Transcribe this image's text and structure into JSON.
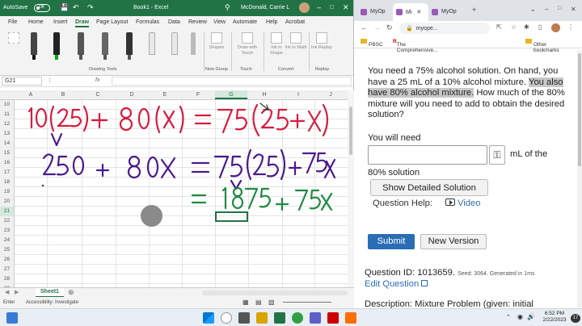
{
  "excel": {
    "autosave_label": "AutoSave",
    "autosave_state": "Off",
    "title": "Book1 - Excel",
    "user": "McDonald, Carrie L",
    "tabs": [
      "File",
      "Home",
      "Insert",
      "Draw",
      "Page Layout",
      "Formulas",
      "Data",
      "Review",
      "View",
      "Automate",
      "Help",
      "Acrobat"
    ],
    "active_tab": "Draw",
    "ribbon": {
      "drawing_tools_label": "Drawing Tools",
      "shapes_label": "Shapes",
      "draw_with_touch_label": "Draw with Touch",
      "ink_to_shape_label": "Ink to Shape",
      "ink_to_math_label": "Ink to Math",
      "ink_replay_label": "Ink Replay",
      "groups": [
        "New Group",
        "Touch",
        "Convert",
        "Replay"
      ]
    },
    "name_box": "G21",
    "fx_label": "fx",
    "columns": [
      "A",
      "B",
      "C",
      "D",
      "E",
      "F",
      "G",
      "H",
      "I",
      "J"
    ],
    "selected_column": "G",
    "rows": [
      "10",
      "11",
      "12",
      "13",
      "14",
      "15",
      "16",
      "17",
      "18",
      "19",
      "20",
      "21",
      "22",
      "23",
      "24",
      "25",
      "26",
      "27",
      "28",
      "29"
    ],
    "selected_row": "21",
    "sheet_tab": "Sheet1",
    "status_mode": "Enter",
    "accessibility": "Accessibility: Investigate",
    "colors": {
      "brand": "#217346"
    }
  },
  "browser": {
    "tabs": [
      {
        "label": "MyOp"
      },
      {
        "label": "Mi"
      },
      {
        "label": "MyOp"
      }
    ],
    "url": "myope...",
    "bookmarks": [
      "PBSC",
      "The Comprehensive..."
    ],
    "other_bookmarks": "Other bookmarks"
  },
  "question": {
    "text_before": "You need a 75% alcohol solution. On hand, you have a 25 mL of a 10% alcohol mixture. ",
    "text_highlight": "You also have 80% alcohol mixture.",
    "text_after": " How much of the 80% mixture will you need to add to obtain the desired solution?",
    "you_will_need": "You will need",
    "answer_value": "",
    "unit_line1": "mL of the",
    "unit_line2": "80% solution",
    "show_solution": "Show Detailed Solution",
    "question_help": "Question Help:",
    "video": "Video",
    "submit": "Submit",
    "new_version": "New Version",
    "question_id": "Question ID: 1013659.",
    "seed_info": "Seed: 3064. Generated in 1ms",
    "edit_question": "Edit Question",
    "description": "Description: Mixture Problem (given: initial"
  },
  "taskbar": {
    "time": "6:52 PM",
    "date": "2/22/2023",
    "notification_count": "17"
  }
}
